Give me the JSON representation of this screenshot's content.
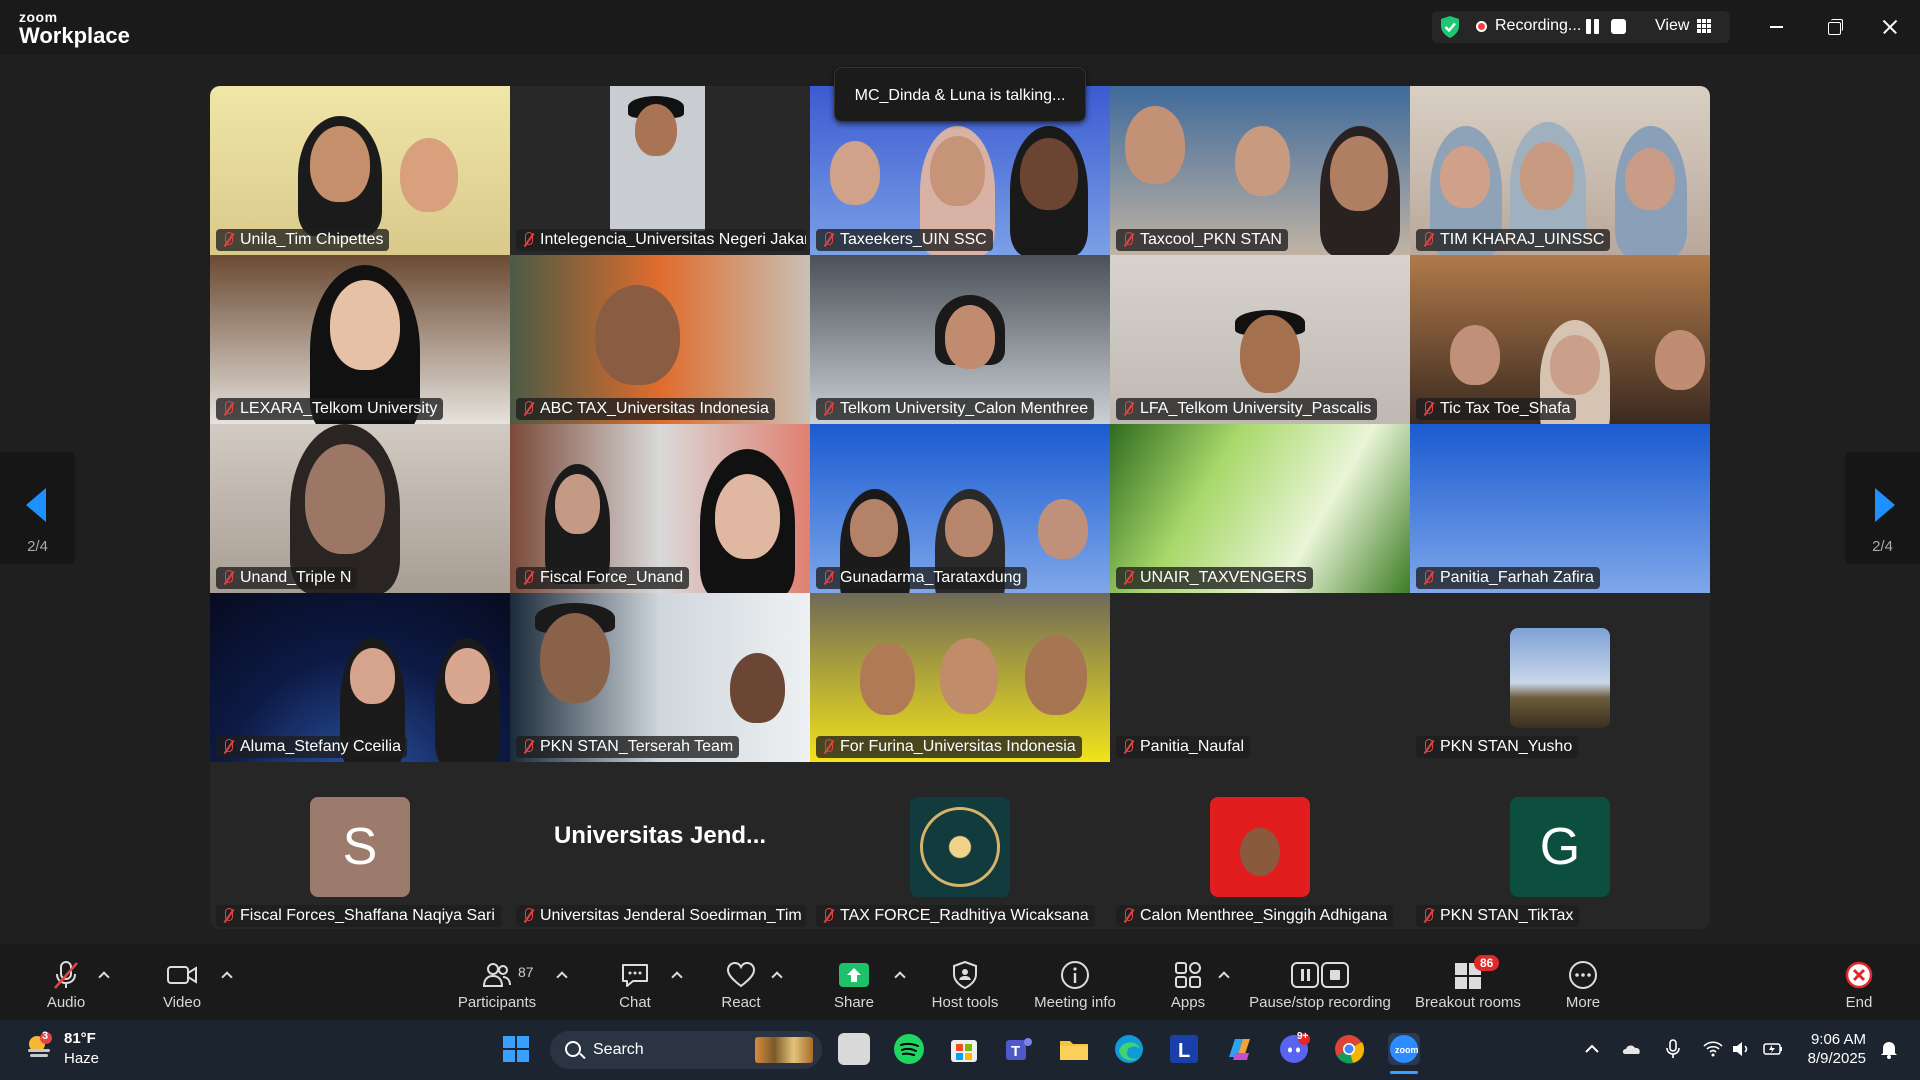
{
  "app": {
    "brand_small": "zoom",
    "brand_large": "Workplace"
  },
  "recording": {
    "label": "Recording...",
    "view_label": "View"
  },
  "talking_banner": "MC_Dinda & Luna is talking...",
  "pager": {
    "left": "2/4",
    "right": "2/4"
  },
  "tiles": [
    {
      "name": "Unila_Tim Chipettes"
    },
    {
      "name": "Intelegencia_Universitas Negeri Jakar..."
    },
    {
      "name": "Taxeekers_UIN SSC"
    },
    {
      "name": "Taxcool_PKN STAN"
    },
    {
      "name": "TIM KHARAJ_UINSSC"
    },
    {
      "name": "LEXARA_Telkom University"
    },
    {
      "name": "ABC TAX_Universitas Indonesia"
    },
    {
      "name": "Telkom University_Calon Menthree"
    },
    {
      "name": "LFA_Telkom University_Pascalis"
    },
    {
      "name": "Tic Tax Toe_Shafa"
    },
    {
      "name": "Unand_Triple N"
    },
    {
      "name": "Fiscal Force_Unand"
    },
    {
      "name": "Gunadarma_Tarataxdung"
    },
    {
      "name": "UNAIR_TAXVENGERS"
    },
    {
      "name": "Panitia_Farhah Zafira"
    },
    {
      "name": "Aluma_Stefany Cceilia"
    },
    {
      "name": "PKN STAN_Terserah Team"
    },
    {
      "name": "For Furina_Universitas Indonesia"
    },
    {
      "name": "Panitia_Naufal"
    },
    {
      "name": "PKN STAN_Yusho"
    },
    {
      "name": "Fiscal Forces_Shaffana Naqiya Sari",
      "avatar": "S"
    },
    {
      "name": "Universitas Jenderal Soedirman_Tim ...",
      "bigname": "Universitas  Jend..."
    },
    {
      "name": "TAX FORCE_Radhitiya Wicaksana"
    },
    {
      "name": "Calon Menthree_Singgih Adhigana"
    },
    {
      "name": "PKN STAN_TikTax",
      "avatar": "G"
    }
  ],
  "toolbar": {
    "audio": "Audio",
    "video": "Video",
    "participants": "Participants",
    "participants_count": "87",
    "chat": "Chat",
    "react": "React",
    "share": "Share",
    "host_tools": "Host tools",
    "meeting_info": "Meeting info",
    "apps": "Apps",
    "pause_stop": "Pause/stop recording",
    "breakout": "Breakout rooms",
    "breakout_badge": "86",
    "more": "More",
    "end": "End"
  },
  "taskbar": {
    "temp": "81°F",
    "weather": "Haze",
    "weather_badge": "3",
    "search": "Search",
    "time": "9:06 AM",
    "date": "8/9/2025",
    "discord_badge": "9+"
  },
  "colors": {
    "accent": "#1e90ff",
    "muted_red": "#e24343",
    "share_green": "#1fc06a"
  }
}
